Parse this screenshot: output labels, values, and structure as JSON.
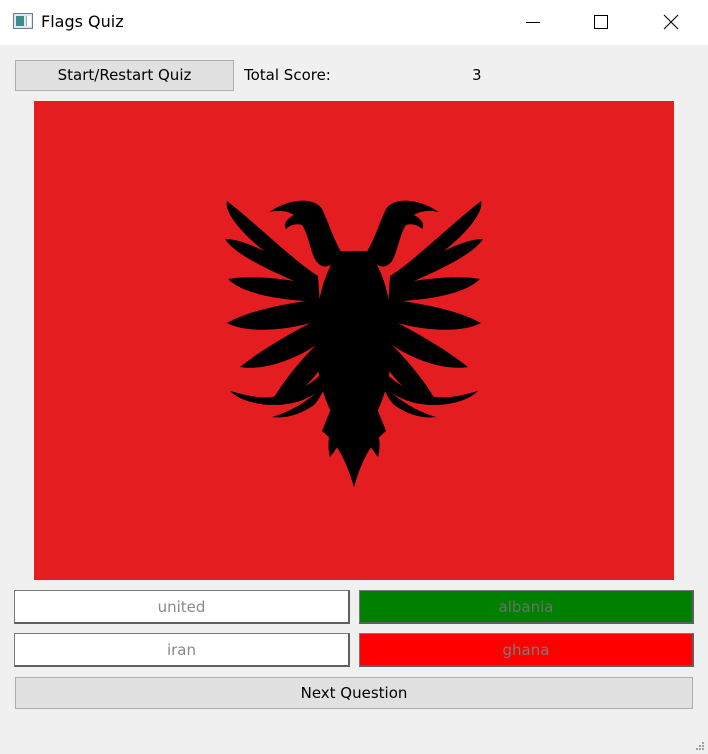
{
  "window": {
    "title": "Flags Quiz",
    "icon": "app-window-icon",
    "controls": [
      "minimize-icon",
      "maximize-icon",
      "close-icon"
    ]
  },
  "toolbar": {
    "start_label": "Start/Restart Quiz",
    "score_label": "Total Score:",
    "score_value": "3"
  },
  "flag": {
    "country": "albania",
    "background_color": "#e41e20",
    "emblem": "double-headed-eagle-icon",
    "emblem_color": "#000000"
  },
  "answers": [
    {
      "label": "united",
      "state": "neutral",
      "color": "#ffffff"
    },
    {
      "label": "albania",
      "state": "correct",
      "color": "#008000"
    },
    {
      "label": "iran",
      "state": "neutral",
      "color": "#ffffff"
    },
    {
      "label": "ghana",
      "state": "wrong",
      "color": "#ff0000"
    }
  ],
  "next_label": "Next Question"
}
